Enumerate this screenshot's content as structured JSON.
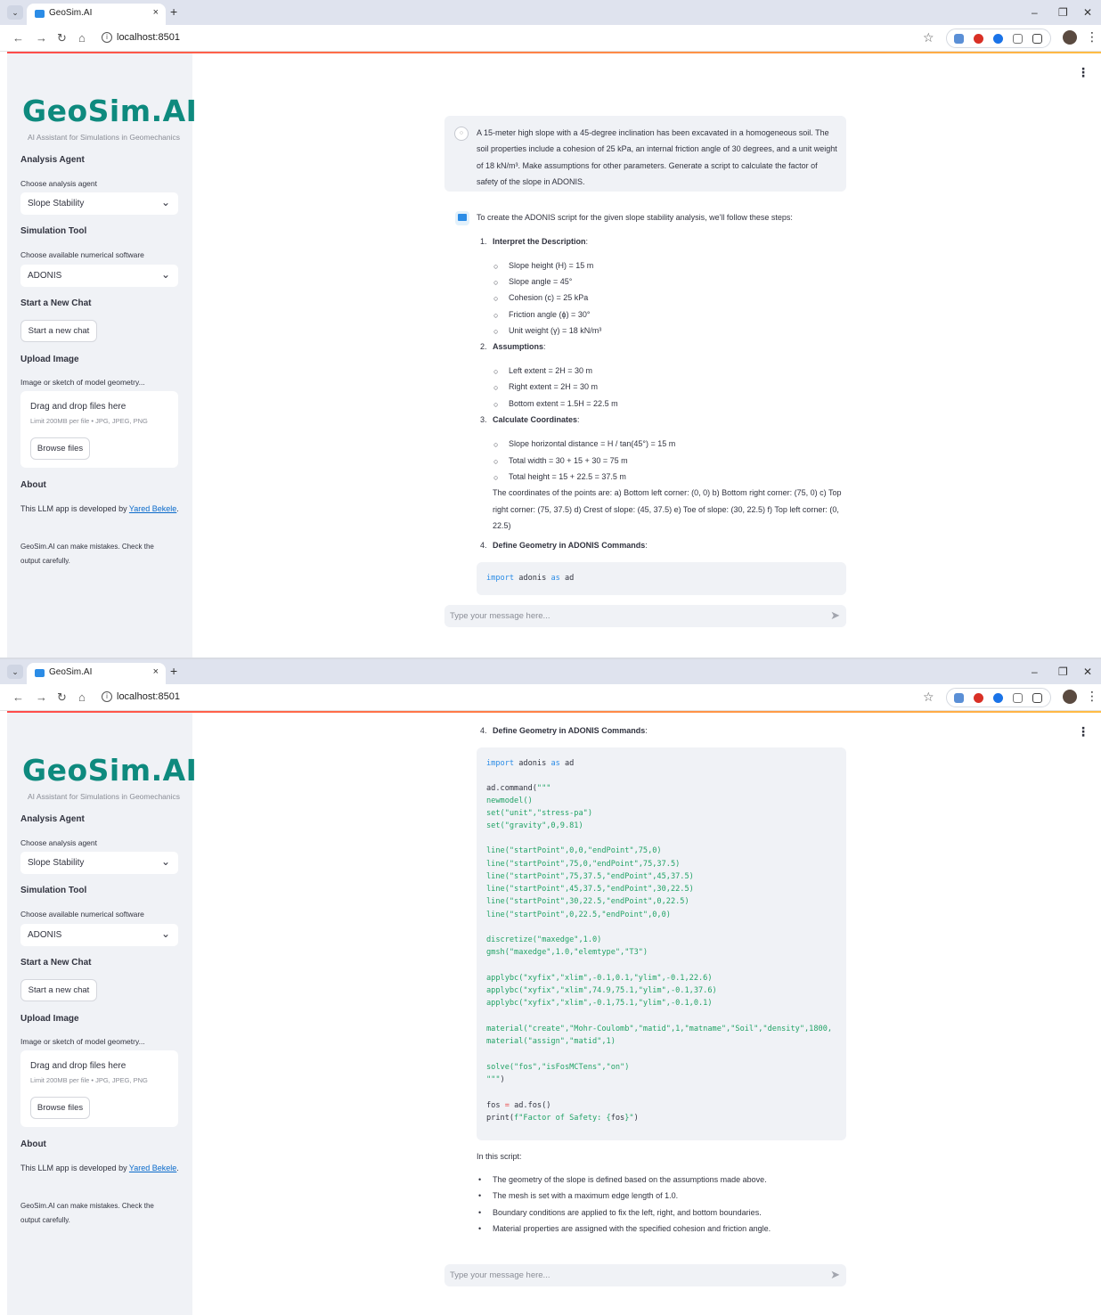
{
  "browser": {
    "tab_menu": "⌄",
    "tab_title": "GeoSim.AI",
    "tab_close": "×",
    "new_tab": "+",
    "minimize": "–",
    "restore": "❐",
    "close": "✕",
    "back": "←",
    "forward": "→",
    "reload": "↻",
    "home": "⌂",
    "info": "i",
    "url": "localhost:8501",
    "bookmark": "☆",
    "menu": "⋮"
  },
  "sidebar": {
    "logo": "GeoSim.AI",
    "subtitle": "AI Assistant for Simulations in Geomechanics",
    "analysis_head": "Analysis Agent",
    "analysis_label": "Choose analysis agent",
    "analysis_value": "Slope Stability",
    "sim_head": "Simulation Tool",
    "sim_label": "Choose available numerical software",
    "sim_value": "ADONIS",
    "chevron": "⌄",
    "newchat_head": "Start a New Chat",
    "newchat_btn": "Start a new chat",
    "upload_head": "Upload Image",
    "upload_label": "Image or sketch of model geometry...",
    "drop_title": "Drag and drop files here",
    "drop_limit": "Limit 200MB per file • JPG, JPEG, PNG",
    "browse_btn": "Browse files",
    "about_head": "About",
    "about_text": "This LLM app is developed by ",
    "about_link": "Yared Bekele",
    "about_period": ".",
    "disclaimer": "GeoSim.AI can make mistakes. Check the output carefully."
  },
  "app_menu": "⋮",
  "chat": {
    "user_icon": "○",
    "user_message": "A 15-meter high slope with a 45-degree inclination has been excavated in a homogeneous soil. The soil properties include a cohesion of 25 kPa, an internal friction angle of 30 degrees, and a unit weight of 18 kN/m³. Make assumptions for other parameters. Generate a script to calculate the factor of safety of the slope in ADONIS.",
    "intro": "To create the ADONIS script for the given slope stability analysis, we'll follow these steps:",
    "s1_num": "1.",
    "s1_title": "Interpret the Description",
    "colon": ":",
    "s1_items": [
      "Slope height (H) = 15 m",
      "Slope angle = 45°",
      "Cohesion (c) = 25 kPa",
      "Friction angle (ϕ) = 30°",
      "Unit weight (γ) = 18 kN/m³"
    ],
    "s2_num": "2.",
    "s2_title": "Assumptions",
    "s2_items": [
      "Left extent = 2H = 30 m",
      "Right extent = 2H = 30 m",
      "Bottom extent = 1.5H = 22.5 m"
    ],
    "s3_num": "3.",
    "s3_title": "Calculate Coordinates",
    "s3_items": [
      "Slope horizontal distance = H / tan(45°) = 15 m",
      "Total width = 30 + 15 + 30 = 75 m",
      "Total height = 15 + 22.5 = 37.5 m"
    ],
    "coords_text": "The coordinates of the points are: a) Bottom left corner: (0, 0) b) Bottom right corner: (75, 0) c) Top right corner: (75, 37.5) d) Crest of slope: (45, 37.5) e) Toe of slope: (30, 22.5) f) Top left corner: (0, 22.5)",
    "s4_num": "4.",
    "s4_title": "Define Geometry in ADONIS Commands",
    "bullet_o": "○",
    "bullet_dot": "•",
    "code": {
      "import_kw": "import",
      "import_mod": " adonis ",
      "as_kw": "as",
      "import_alias": " ad",
      "cmd_open_a": "ad.command(",
      "cmd_open_b": "\"\"\"",
      "l_newmodel": "newmodel()",
      "l_set1": "set(\"unit\",\"stress-pa\")",
      "l_set2": "set(\"gravity\",0,9.81)",
      "l_line1": "line(\"startPoint\",0,0,\"endPoint\",75,0)",
      "l_line2": "line(\"startPoint\",75,0,\"endPoint\",75,37.5)",
      "l_line3": "line(\"startPoint\",75,37.5,\"endPoint\",45,37.5)",
      "l_line4": "line(\"startPoint\",45,37.5,\"endPoint\",30,22.5)",
      "l_line5": "line(\"startPoint\",30,22.5,\"endPoint\",0,22.5)",
      "l_line6": "line(\"startPoint\",0,22.5,\"endPoint\",0,0)",
      "l_disc": "discretize(\"maxedge\",1.0)",
      "l_gmsh": "gmsh(\"maxedge\",1.0,\"elemtype\",\"T3\")",
      "l_bc1": "applybc(\"xyfix\",\"xlim\",-0.1,0.1,\"ylim\",-0.1,22.6)",
      "l_bc2": "applybc(\"xyfix\",\"xlim\",74.9,75.1,\"ylim\",-0.1,37.6)",
      "l_bc3": "applybc(\"xyfix\",\"xlim\",-0.1,75.1,\"ylim\",-0.1,0.1)",
      "l_mat1": "material(\"create\",\"Mohr-Coulomb\",\"matid\",1,\"matname\",\"Soil\",\"density\",1800,",
      "l_mat2": "material(\"assign\",\"matid\",1)",
      "l_solve": "solve(\"fos\",\"isFosMCTens\",\"on\")",
      "l_close_a": "\"\"\"",
      "l_close_b": ")",
      "fos_var": "fos ",
      "fos_eq": "=",
      "fos_call": " ad.fos()",
      "print_a": "print(",
      "print_b": "f\"Factor of Safety: {",
      "print_c": "fos",
      "print_d": "}\"",
      "print_e": ")"
    },
    "script_intro": "In this script:",
    "script_items": [
      "The geometry of the slope is defined based on the assumptions made above.",
      "The mesh is set with a maximum edge length of 1.0.",
      "Boundary conditions are applied to fix the left, right, and bottom boundaries.",
      "Material properties are assigned with the specified cohesion and friction angle."
    ],
    "input_placeholder": "Type your message here...",
    "send_icon": "➤"
  },
  "colors": {
    "accent": "#0e8a7e",
    "sidebar_bg": "#f0f2f6",
    "link": "#0b6bcb",
    "keyword": "#2b8ce6",
    "string": "#21a366"
  }
}
